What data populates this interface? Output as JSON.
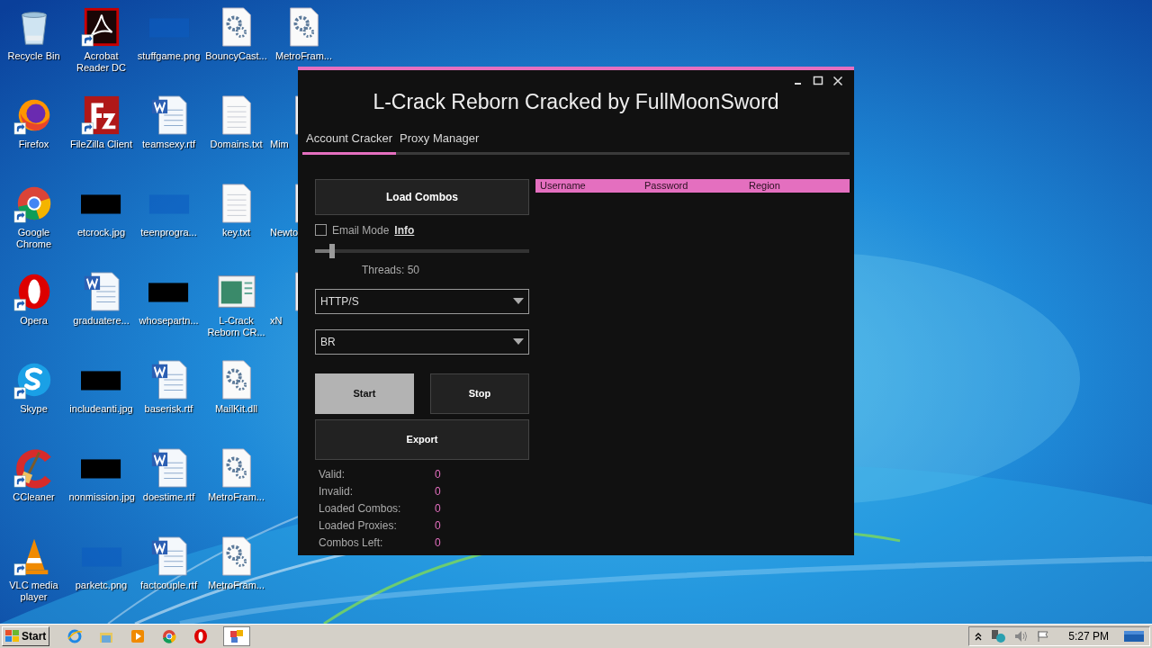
{
  "desktop": {
    "icons": [
      {
        "label": "Recycle Bin",
        "kind": "recycle",
        "shortcut": false,
        "partial": false
      },
      {
        "label": "Firefox",
        "kind": "firefox",
        "shortcut": true,
        "partial": false
      },
      {
        "label": "Google Chrome",
        "kind": "chrome",
        "shortcut": true,
        "partial": false
      },
      {
        "label": "Opera",
        "kind": "opera",
        "shortcut": true,
        "partial": false
      },
      {
        "label": "Skype",
        "kind": "skype",
        "shortcut": true,
        "partial": false
      },
      {
        "label": "CCleaner",
        "kind": "ccleaner",
        "shortcut": true,
        "partial": false
      },
      {
        "label": "VLC media player",
        "kind": "vlc",
        "shortcut": true,
        "partial": false
      },
      {
        "label": "Acrobat Reader DC",
        "kind": "pdf",
        "shortcut": true,
        "partial": false
      },
      {
        "label": "FileZilla Client",
        "kind": "filezilla",
        "shortcut": true,
        "partial": false
      },
      {
        "label": "etcrock.jpg",
        "kind": "black",
        "shortcut": false,
        "partial": false
      },
      {
        "label": "graduatere...",
        "kind": "word",
        "shortcut": false,
        "partial": false
      },
      {
        "label": "includeanti.jpg",
        "kind": "black",
        "shortcut": false,
        "partial": false
      },
      {
        "label": "nonmission.jpg",
        "kind": "black",
        "shortcut": false,
        "partial": false
      },
      {
        "label": "parketc.png",
        "kind": "blank",
        "shortcut": false,
        "partial": false
      },
      {
        "label": "stuffgame.png",
        "kind": "blank",
        "shortcut": false,
        "partial": false
      },
      {
        "label": "teamsexy.rtf",
        "kind": "word",
        "shortcut": false,
        "partial": false
      },
      {
        "label": "teenprogra...",
        "kind": "blank",
        "shortcut": false,
        "partial": false
      },
      {
        "label": "whosepartn...",
        "kind": "black",
        "shortcut": false,
        "partial": false
      },
      {
        "label": "baserisk.rtf",
        "kind": "word",
        "shortcut": false,
        "partial": false
      },
      {
        "label": "doestime.rtf",
        "kind": "word",
        "shortcut": false,
        "partial": false
      },
      {
        "label": "factcouple.rtf",
        "kind": "word",
        "shortcut": false,
        "partial": false
      },
      {
        "label": "BouncyCast...",
        "kind": "gear",
        "shortcut": false,
        "partial": false
      },
      {
        "label": "Domains.txt",
        "kind": "text",
        "shortcut": false,
        "partial": false
      },
      {
        "label": "key.txt",
        "kind": "text",
        "shortcut": false,
        "partial": false
      },
      {
        "label": "L-Crack Reborn CR...",
        "kind": "app",
        "shortcut": false,
        "partial": false
      },
      {
        "label": "MailKit.dll",
        "kind": "gear",
        "shortcut": false,
        "partial": false
      },
      {
        "label": "MetroFram...",
        "kind": "gear",
        "shortcut": false,
        "partial": false
      },
      {
        "label": "MetroFram...",
        "kind": "gear",
        "shortcut": false,
        "partial": false
      },
      {
        "label": "MetroFram...",
        "kind": "gear",
        "shortcut": false,
        "partial": false
      },
      {
        "label": "Mim",
        "kind": "gear",
        "shortcut": false,
        "partial": true
      },
      {
        "label": "Newto",
        "kind": "gear",
        "shortcut": false,
        "partial": true
      },
      {
        "label": "xN",
        "kind": "gear",
        "shortcut": false,
        "partial": true
      }
    ]
  },
  "window": {
    "title": "L-Crack Reborn Cracked by FullMoonSword",
    "tabs": [
      {
        "label": "Account Cracker",
        "selected": true
      },
      {
        "label": "Proxy Manager",
        "selected": false
      }
    ],
    "load_button": "Load Combos",
    "email_mode": {
      "label": "Email Mode",
      "checked": false,
      "link": "Info"
    },
    "threads_slider": {
      "level": 0.08
    },
    "threads_label": "Threads: 50",
    "dropdowns": [
      {
        "value": "HTTP/S"
      },
      {
        "value": "BR"
      }
    ],
    "buttons": [
      {
        "label": "Start",
        "highlighted": true
      },
      {
        "label": "Stop",
        "highlighted": false
      }
    ],
    "export_button": "Export",
    "stats": [
      {
        "label": "Valid:",
        "value": "0"
      },
      {
        "label": "Invalid:",
        "value": "0"
      },
      {
        "label": "Loaded Combos:",
        "value": "0"
      },
      {
        "label": "Loaded Proxies:",
        "value": "0"
      },
      {
        "label": "Combos Left:",
        "value": "0"
      }
    ],
    "table": {
      "columns": [
        "Username",
        "Password",
        "Region"
      ]
    }
  },
  "taskbar": {
    "start": "Start",
    "apps": [
      {
        "kind": "ie",
        "selected": false
      },
      {
        "kind": "folder",
        "selected": false
      },
      {
        "kind": "media",
        "selected": false
      },
      {
        "kind": "chrome",
        "selected": false
      },
      {
        "kind": "opera",
        "selected": false
      },
      {
        "kind": "app",
        "selected": true
      }
    ],
    "clock": "5:27 PM"
  }
}
